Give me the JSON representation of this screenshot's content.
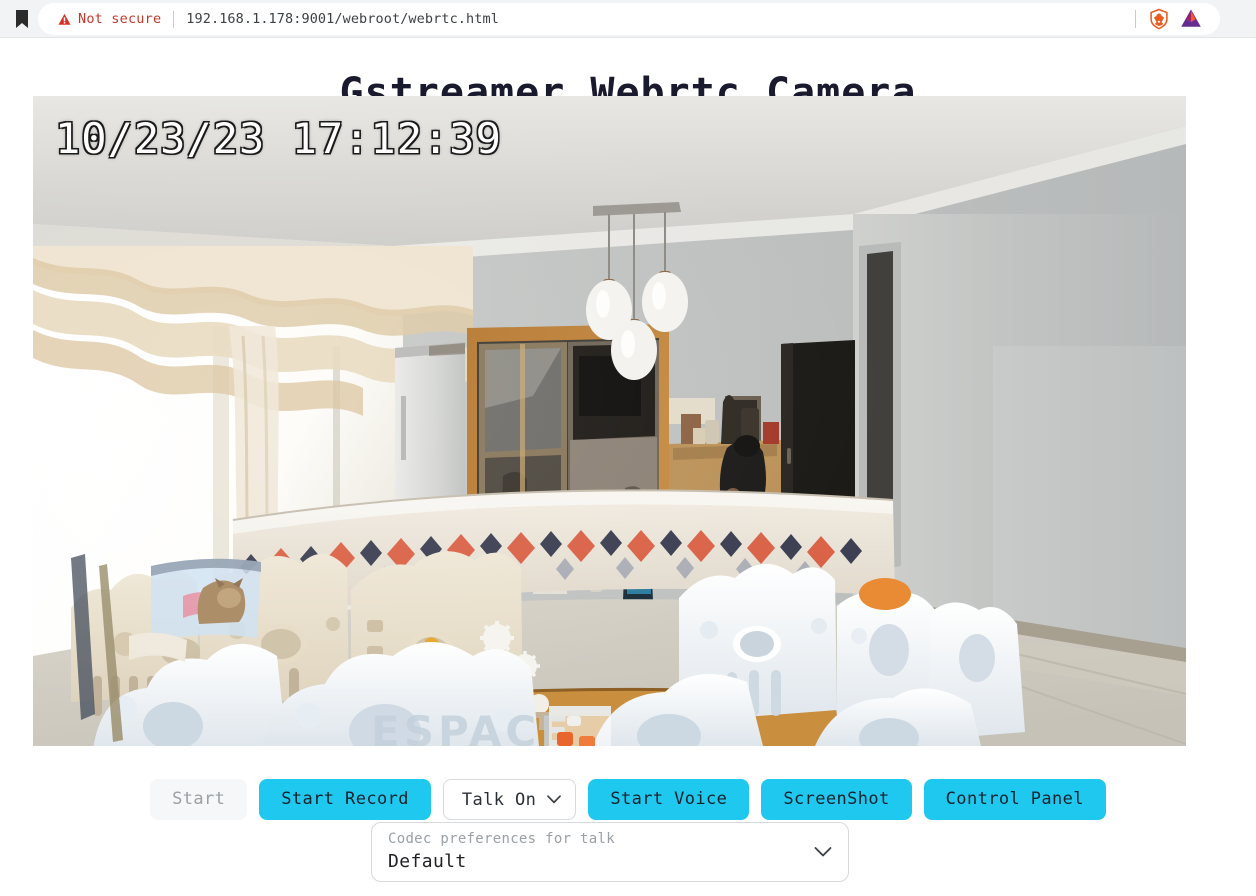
{
  "browser": {
    "bookmark_icon": "bookmark-icon",
    "security_warning": "Not secure",
    "warning_icon": "warning-triangle-icon",
    "url": "192.168.1.178:9001/webroot/webrtc.html",
    "brave_shield_icon": "brave-lion-shield-icon",
    "bat_icon": "bat-triangle-icon",
    "colors": {
      "warning_red": "#c0392b",
      "url_text": "#3c4043",
      "chrome_bg": "#f1f3f4"
    }
  },
  "page": {
    "title": "Gstreamer Webrtc Camera",
    "title_color": "#1a1a2e",
    "background": "#ffffff"
  },
  "video": {
    "name": "webrtc-video-stream",
    "timestamp_overlay": "10/23/23 17:12:39",
    "date": "10/23/23",
    "time": "17:12:39",
    "scene_description": "Indoor living room viewed by a wide-angle IP camera: bright curtained window on the left, white refrigerator, wooden-framed doorway to a kitchen, three pendant lamps on the ceiling, a dark door, a patterned sofa throw, a cream and white baby playpen on a tiled floor."
  },
  "controls": {
    "buttons": [
      {
        "label": "Start",
        "name": "start-button",
        "style": "disabled"
      },
      {
        "label": "Start Record",
        "name": "start-record-button",
        "style": "primary"
      },
      {
        "label": "Talk On",
        "name": "talk-on-select",
        "style": "select"
      },
      {
        "label": "Start Voice",
        "name": "start-voice-button",
        "style": "primary"
      },
      {
        "label": "ScreenShot",
        "name": "screenshot-button",
        "style": "primary"
      },
      {
        "label": "Control Panel",
        "name": "control-panel-button",
        "style": "primary"
      }
    ],
    "accent_color": "#1fc8ef",
    "disabled_color": "#9aa0a6"
  },
  "codec_select": {
    "name": "codec-preferences-select",
    "label": "Codec preferences for talk",
    "value": "Default",
    "chevron_icon": "chevron-down-icon"
  }
}
